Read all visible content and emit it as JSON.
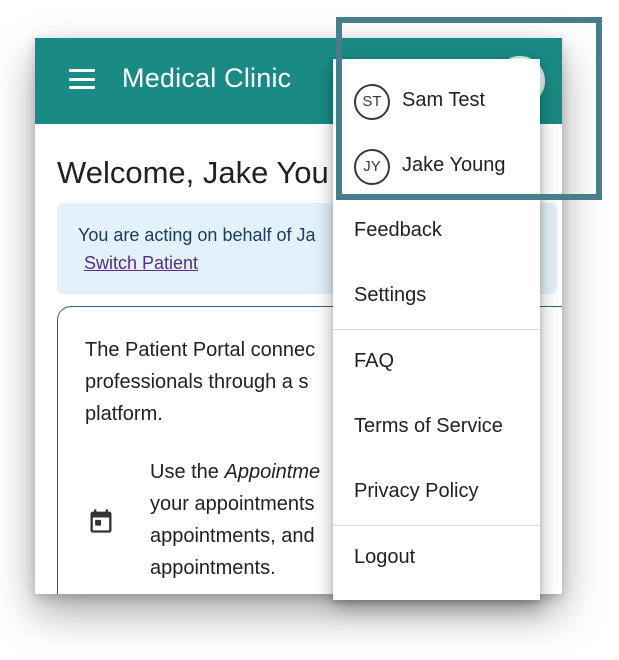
{
  "appbar": {
    "title": "Medical Clinic"
  },
  "welcome": {
    "title": "Welcome, Jake You"
  },
  "alert": {
    "text": "You are acting on behalf of Ja",
    "switch_label": "Switch Patient"
  },
  "card": {
    "intro_lines": [
      "The Patient Portal connec",
      "professionals through a s",
      "platform."
    ],
    "list_item": {
      "lead": "Use the ",
      "emphasis": "Appointme",
      "lines": [
        "your appointments",
        "appointments, and",
        "appointments."
      ]
    }
  },
  "account_menu": {
    "users": [
      {
        "initials": "ST",
        "name": "Sam Test"
      },
      {
        "initials": "JY",
        "name": "Jake Young"
      }
    ],
    "items": [
      "Feedback",
      "Settings",
      "FAQ",
      "Terms of Service",
      "Privacy Policy",
      "Logout"
    ]
  },
  "colors": {
    "appbar": "#1a8a84",
    "alert_bg": "#e3f1fb",
    "link": "#5a2d82",
    "highlight_border": "#4a7d8c"
  },
  "icons": [
    "menu-icon",
    "calendar-icon",
    "avatar"
  ]
}
